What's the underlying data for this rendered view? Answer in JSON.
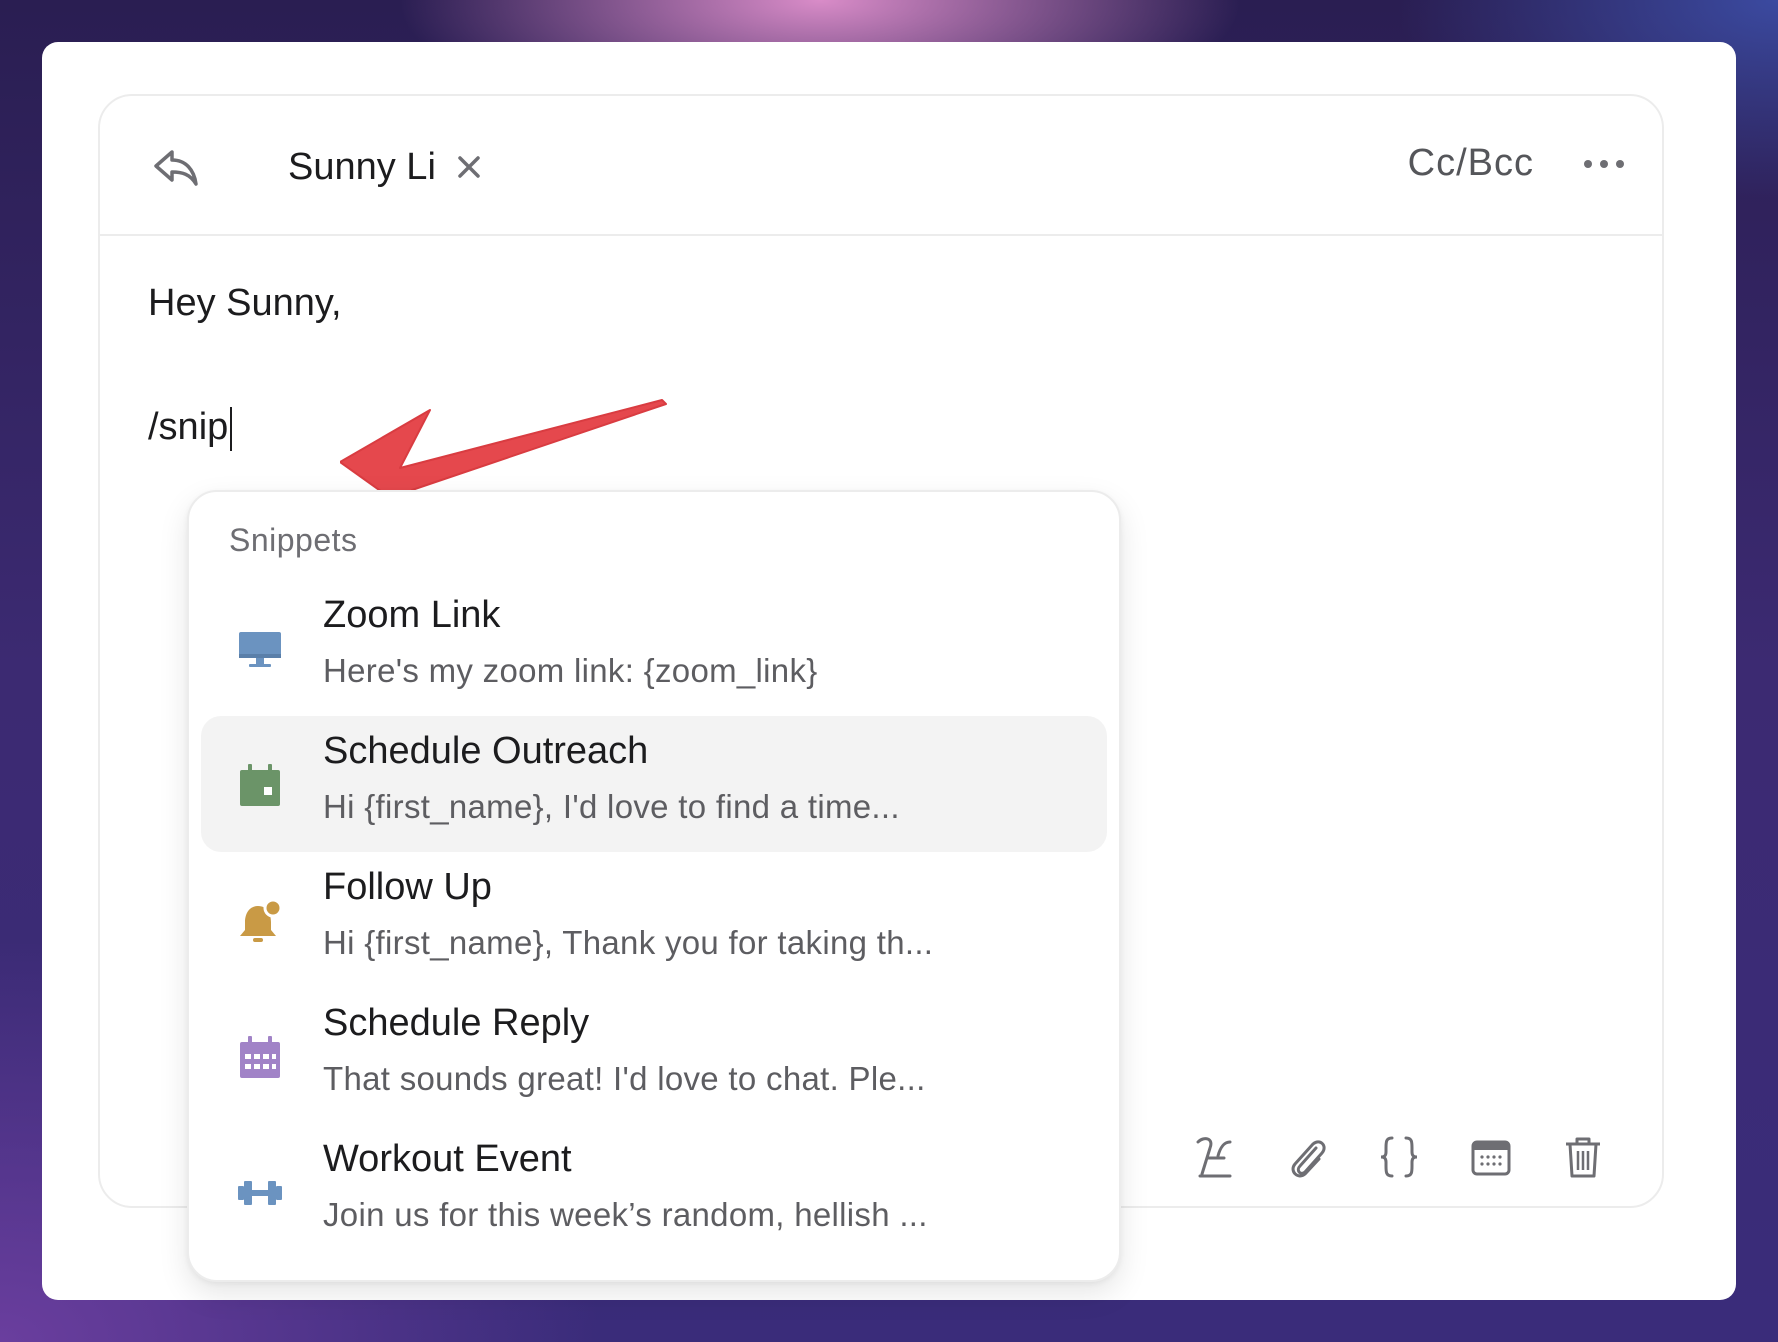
{
  "composer": {
    "recipient": "Sunny Li",
    "cc_bcc_label": "Cc/Bcc",
    "greeting": "Hey Sunny,",
    "typed_command": "/snip"
  },
  "snippets_menu": {
    "title": "Snippets",
    "items": [
      {
        "name": "Zoom Link",
        "preview": "Here's my zoom link: {zoom_link}",
        "icon": "monitor-icon",
        "color": "#6b93c0"
      },
      {
        "name": "Schedule Outreach",
        "preview": "Hi {first_name}, I'd love to find a time...",
        "icon": "calendar-icon",
        "color": "#6b9468"
      },
      {
        "name": "Follow Up",
        "preview": "Hi {first_name}, Thank you for taking th...",
        "icon": "bell-icon",
        "color": "#c99a45"
      },
      {
        "name": "Schedule Reply",
        "preview": "That sounds great! I'd love to chat. Ple...",
        "icon": "calendar-grid-icon",
        "color": "#a183c7"
      },
      {
        "name": "Workout Event",
        "preview": "Join us for this week’s random, hellish ...",
        "icon": "dumbbell-icon",
        "color": "#6b93c0"
      }
    ]
  },
  "toolbar": {
    "icons": [
      "signature-icon",
      "paperclip-icon",
      "braces-icon",
      "calendar-icon",
      "trash-icon"
    ]
  },
  "colors": {
    "annotation_arrow": "#e5484d",
    "active_row": "#f3f3f3"
  }
}
